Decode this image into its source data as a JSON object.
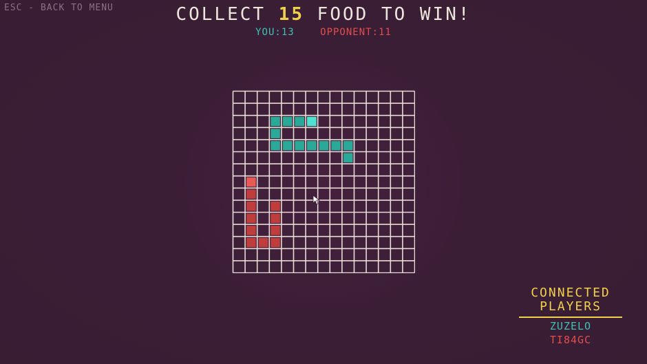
{
  "header": {
    "back_hint": "ESC - BACK TO MENU",
    "title_prefix": "COLLECT",
    "food_goal": "15",
    "title_suffix": "FOOD TO WIN!"
  },
  "scores": {
    "you": "YOU:13",
    "opponent": "OPPONENT:11"
  },
  "board": {
    "cols": 15,
    "rows": 15,
    "grid_color": "#e9dcd7",
    "player_snake": {
      "color": "#2aa898",
      "head_color": "#4fe0cf",
      "head": [
        6,
        2
      ],
      "body": [
        [
          5,
          2
        ],
        [
          4,
          2
        ],
        [
          3,
          2
        ],
        [
          3,
          3
        ],
        [
          3,
          4
        ],
        [
          4,
          4
        ],
        [
          5,
          4
        ],
        [
          6,
          4
        ],
        [
          7,
          4
        ],
        [
          8,
          4
        ],
        [
          9,
          4
        ],
        [
          9,
          5
        ]
      ]
    },
    "opponent_snake": {
      "color": "#bf3d3d",
      "head_color": "#e85a55",
      "head": [
        1,
        7
      ],
      "body": [
        [
          1,
          8
        ],
        [
          1,
          9
        ],
        [
          1,
          10
        ],
        [
          1,
          11
        ],
        [
          1,
          12
        ],
        [
          2,
          12
        ],
        [
          3,
          12
        ],
        [
          3,
          11
        ],
        [
          3,
          10
        ],
        [
          3,
          9
        ]
      ]
    }
  },
  "connected_players": {
    "heading_line1": "CONNECTED",
    "heading_line2": "PLAYERS",
    "players": [
      "ZUZELO",
      "TI84GC"
    ]
  }
}
